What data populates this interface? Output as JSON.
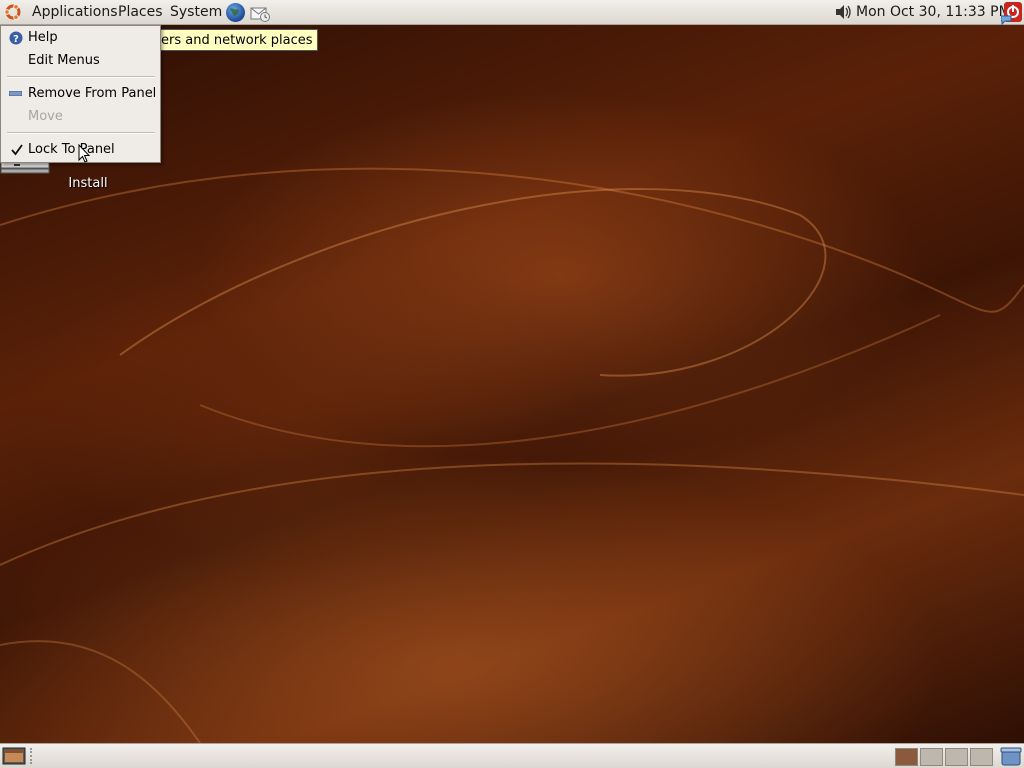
{
  "panel": {
    "menus": {
      "applications": "Applications",
      "places": "Places",
      "system": "System"
    },
    "clock": "Mon Oct 30, 11:33 PM"
  },
  "tooltip": {
    "text": "ers and network places"
  },
  "context_menu": {
    "items": [
      {
        "label": "Help",
        "icon": "help-icon",
        "enabled": true
      },
      {
        "label": "Edit Menus",
        "enabled": true
      },
      {
        "label": "Remove From Panel",
        "icon": "remove-icon",
        "enabled": true
      },
      {
        "label": "Move",
        "enabled": false
      },
      {
        "label": "Lock To Panel",
        "icon": "check-icon",
        "checked": true,
        "enabled": true
      }
    ]
  },
  "desktop": {
    "install_label": "Install"
  },
  "colors": {
    "panel": "#dcd8d0",
    "tooltip": "#ffffbf",
    "menu_bg": "#efebe7",
    "workspace_active": "#8b5a3c"
  }
}
